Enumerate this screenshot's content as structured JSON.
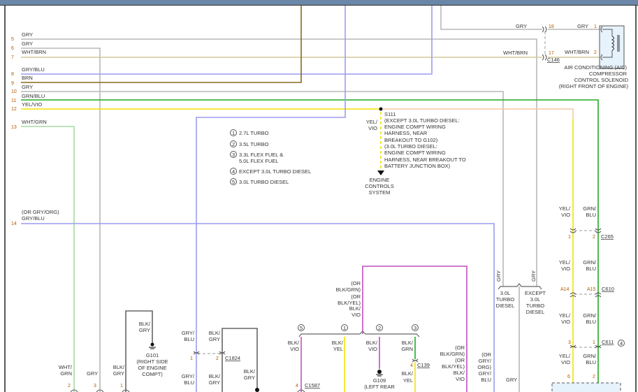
{
  "rows": [
    {
      "num": "5",
      "label": "GRY"
    },
    {
      "num": "6",
      "label": "GRY"
    },
    {
      "num": "7",
      "label": "WHT/BRN"
    },
    {
      "num": "8",
      "label": "GRY/BLU"
    },
    {
      "num": "9",
      "label": "BRN"
    },
    {
      "num": "10",
      "label": "GRY"
    },
    {
      "num": "11",
      "label": "GRN/BLU"
    },
    {
      "num": "12",
      "label": "YEL/VIO"
    },
    {
      "num": "13",
      "label": "WHT/GRN"
    },
    {
      "num": "14",
      "label": "GRY/BLU",
      "alt": "(OR GRY/ORG)"
    }
  ],
  "c146": {
    "name": "C146",
    "pin18": "18",
    "pin17": "17",
    "w18": "GRY",
    "w17": "WHT/BRN"
  },
  "solenoid": {
    "pin1": "1",
    "pin2": "2",
    "w1": "GRY",
    "w2": "WHT/BRN",
    "name": [
      "AIR CONDITIONING (A/C)",
      "COMPRESSOR",
      "CONTROL SOLENOID",
      "(RIGHT FRONT OF ENGINE)"
    ]
  },
  "legend": [
    {
      "n": "1",
      "t": "2.7L TURBO"
    },
    {
      "n": "2",
      "t": "3.5L TURBO"
    },
    {
      "n": "3",
      "t": "3.3L FLEX FUEL &",
      "t2": "5.0L FLEX FUEL"
    },
    {
      "n": "4",
      "t": "EXCEPT 3.0L TURBO DIESEL"
    },
    {
      "n": "5",
      "t": "3.0L TURBO DIESEL"
    }
  ],
  "splice": {
    "wire": [
      "YEL/",
      "VIO"
    ],
    "lines": [
      "S111",
      "(EXCEPT 3.0L TURBO DIESEL:",
      "ENGINE COMPT WIRING",
      "HARNESS, NEAR",
      "BREAKOUT TO G102)",
      "(3.0L TURBO DIESEL:",
      "ENGINE COMPT WIRING",
      "HARNESS, NEAR BREAKOUT TO",
      "BATTERY JUNCTION BOX)"
    ],
    "dest": [
      "ENGINE",
      "CONTROLS",
      "SYSTEM"
    ]
  },
  "right": {
    "w_yv": [
      "YEL/",
      "VIO"
    ],
    "w_gb": [
      "GRN/",
      "BLU"
    ],
    "c265": {
      "name": "C265",
      "p1": "1",
      "p2": "2"
    },
    "c610": {
      "name": "C610",
      "p1": "A14",
      "p2": "A15"
    },
    "c611": {
      "name": "C611",
      "p1": "3",
      "p2": "1",
      "opt": "4"
    },
    "bottom": {
      "p1": "6",
      "p2": "2"
    }
  },
  "diesel": {
    "gry": "GRY",
    "left": [
      "3.0L",
      "TURBO",
      "DIESEL"
    ],
    "right": [
      "EXCEPT",
      "3.0L",
      "TURBO",
      "DIESEL"
    ],
    "bottom": "GRY"
  },
  "bottom": {
    "wg": [
      "WHT/",
      "GRN"
    ],
    "wg_pin": "2",
    "gry": "GRY",
    "gry_pin": "3",
    "bg": [
      "BLK/",
      "GRY"
    ],
    "bg_pin": "1",
    "g101": {
      "wire": [
        "BLK/",
        "GRY"
      ],
      "name": [
        "G101",
        "(RIGHT SIDE",
        "OF ENGINE",
        "COMPT)"
      ]
    },
    "c1824": {
      "name": "C1824",
      "p1": "1",
      "p2": "2",
      "w1": [
        "GRY/",
        "BLU"
      ],
      "w2": [
        "BLK/",
        "GRY"
      ],
      "w1b": [
        "GRY/",
        "BLU"
      ],
      "w2b": [
        "BLK/",
        "GRY"
      ],
      "w3": [
        "BLK/",
        "GRY"
      ]
    },
    "vio_top": [
      "(OR",
      "BLK/GRN)",
      "(OR",
      "BLK/YEL)",
      "BLK/",
      "VIO"
    ],
    "branches": [
      {
        "n": "5",
        "w": [
          "BLK/",
          "VIO"
        ]
      },
      {
        "n": "1",
        "w": [
          "BLK/",
          "YEL"
        ]
      },
      {
        "n": "2",
        "w": [
          "BLK/",
          "VIO"
        ]
      },
      {
        "n": "3",
        "w": [
          "BLK/",
          "GRN"
        ]
      }
    ],
    "c1587": {
      "name": "C1587",
      "pin": "4"
    },
    "c139": {
      "name": "C139",
      "pin": "4",
      "w": [
        "BLK/",
        "YEL"
      ]
    },
    "g109": {
      "name": [
        "G109",
        "(LEFT REAR"
      ]
    },
    "vio_right": [
      "(OR",
      "BLK/GRN)",
      "(OR",
      "BLK/YEL)",
      "BLK/",
      "VIO"
    ],
    "gb_right": [
      "(OR",
      "GRY/",
      "ORG)",
      "GRY/",
      "BLU"
    ]
  }
}
